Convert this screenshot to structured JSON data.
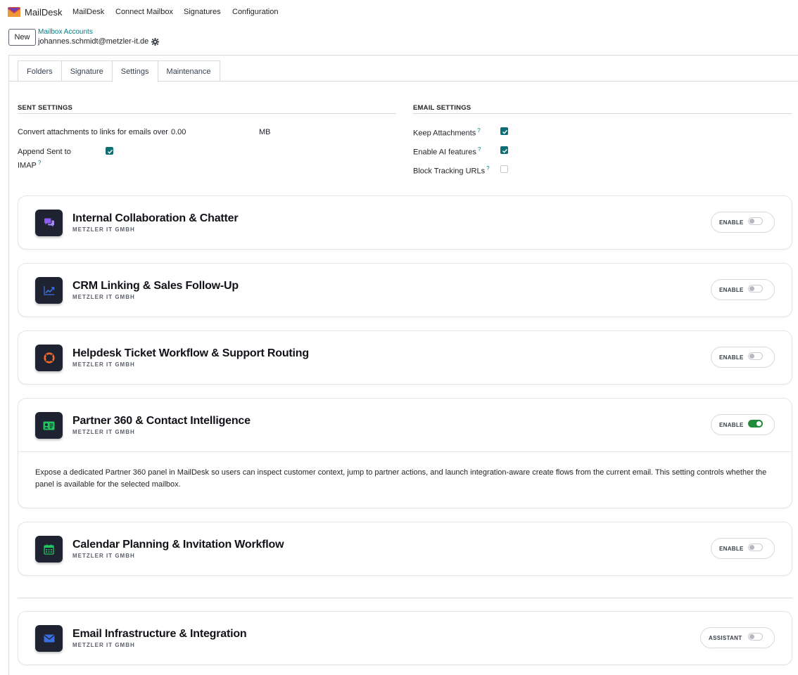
{
  "app": {
    "name": "MailDesk",
    "brand_color": "#e4572e",
    "menu": [
      "MailDesk",
      "Connect Mailbox",
      "Signatures",
      "Configuration"
    ]
  },
  "control_panel": {
    "new_button": "New",
    "breadcrumb": "Mailbox Accounts",
    "record_name": "johannes.schmidt@metzler-it.de"
  },
  "tabs": [
    {
      "label": "Folders",
      "active": false
    },
    {
      "label": "Signature",
      "active": false
    },
    {
      "label": "Settings",
      "active": true
    },
    {
      "label": "Maintenance",
      "active": false
    }
  ],
  "sent_settings": {
    "title": "SENT SETTINGS",
    "convert_label": "Convert attachments to links for emails over",
    "convert_value": "0.00",
    "convert_unit": "MB",
    "append_label_line1": "Append Sent to",
    "append_label_line2": "IMAP",
    "append_checked": true,
    "help": "?"
  },
  "email_settings": {
    "title": "EMAIL SETTINGS",
    "fields": [
      {
        "label": "Keep Attachments",
        "checked": true
      },
      {
        "label": "Enable AI features",
        "checked": true
      },
      {
        "label": "Block Tracking URLs",
        "checked": false
      }
    ],
    "help": "?"
  },
  "cards": [
    {
      "title": "Internal Collaboration & Chatter",
      "subtitle": "METZLER IT GMBH",
      "toggle_label": "ENABLE",
      "enabled": false,
      "icon": "chat-icon",
      "icon_color": "#8b5cf6"
    },
    {
      "title": "CRM Linking & Sales Follow-Up",
      "subtitle": "METZLER IT GMBH",
      "toggle_label": "ENABLE",
      "enabled": false,
      "icon": "trend-chart-icon",
      "icon_color": "#3b6fe0"
    },
    {
      "title": "Helpdesk Ticket Workflow & Support Routing",
      "subtitle": "METZLER IT GMBH",
      "toggle_label": "ENABLE",
      "enabled": false,
      "icon": "lifebuoy-icon",
      "icon_color": "#f26b2a"
    },
    {
      "title": "Partner 360 & Contact Intelligence",
      "subtitle": "METZLER IT GMBH",
      "toggle_label": "ENABLE",
      "enabled": true,
      "icon": "contact-card-icon",
      "icon_color": "#22c55e",
      "description": "Expose a dedicated Partner 360 panel in MailDesk so users can inspect customer context, jump to partner actions, and launch integration-aware create flows from the current email. This setting controls whether the panel is available for the selected mailbox."
    },
    {
      "title": "Calendar Planning & Invitation Workflow",
      "subtitle": "METZLER IT GMBH",
      "toggle_label": "ENABLE",
      "enabled": false,
      "icon": "calendar-icon",
      "icon_color": "#22c55e"
    },
    {
      "title": "Email Infrastructure & Integration",
      "subtitle": "METZLER IT GMBH",
      "toggle_label": "ASSISTANT",
      "enabled": false,
      "icon": "envelope-icon",
      "icon_color": "#3b6fe0"
    }
  ]
}
